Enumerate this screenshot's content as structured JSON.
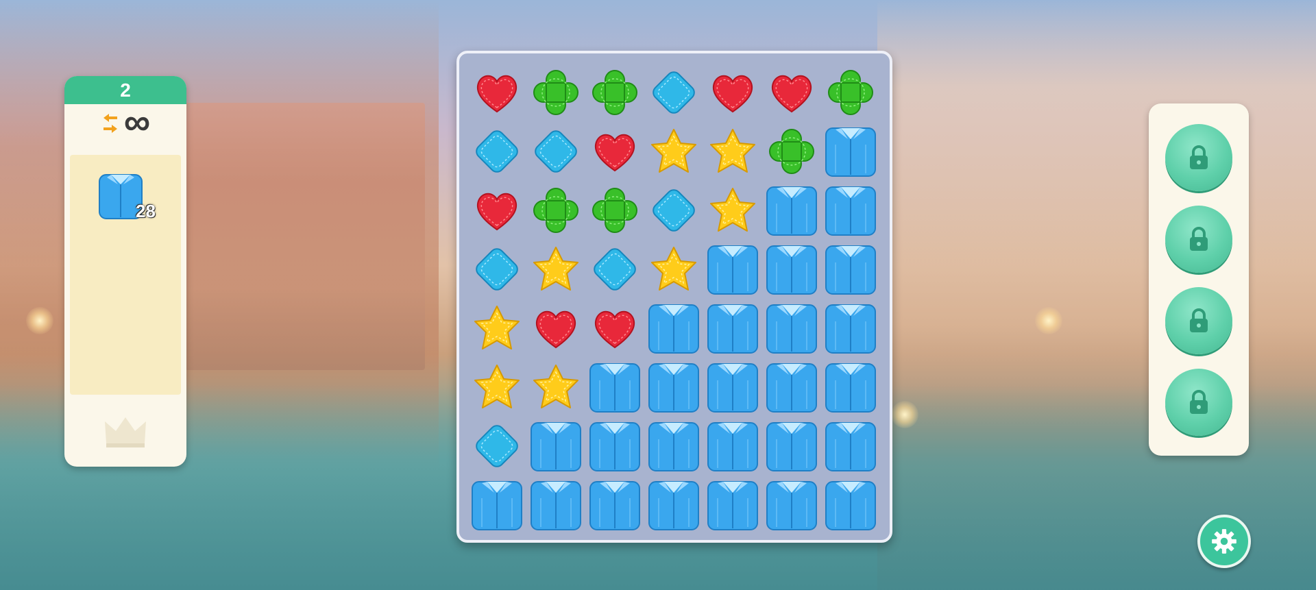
{
  "level": {
    "moves_label": "2",
    "moves_mode": "infinite"
  },
  "goal": {
    "item_icon": "blue-shirt-icon",
    "count": "28"
  },
  "board": {
    "rows": 8,
    "cols": 7,
    "grid": [
      [
        "heart",
        "clover",
        "clover",
        "diamond",
        "heart",
        "heart",
        "clover"
      ],
      [
        "diamond",
        "diamond",
        "heart",
        "star",
        "star",
        "clover",
        "shirt"
      ],
      [
        "heart",
        "clover",
        "clover",
        "diamond",
        "star",
        "shirt",
        "shirt"
      ],
      [
        "diamond",
        "star",
        "diamond",
        "star",
        "shirt",
        "shirt",
        "shirt"
      ],
      [
        "star",
        "heart",
        "heart",
        "shirt",
        "shirt",
        "shirt",
        "shirt"
      ],
      [
        "star",
        "star",
        "shirt",
        "shirt",
        "shirt",
        "shirt",
        "shirt"
      ],
      [
        "diamond",
        "shirt",
        "shirt",
        "shirt",
        "shirt",
        "shirt",
        "shirt"
      ],
      [
        "shirt",
        "shirt",
        "shirt",
        "shirt",
        "shirt",
        "shirt",
        "shirt"
      ]
    ]
  },
  "boosters": [
    {
      "icon": "lock-icon",
      "locked": true
    },
    {
      "icon": "lock-icon",
      "locked": true
    },
    {
      "icon": "lock-icon",
      "locked": true
    },
    {
      "icon": "lock-icon",
      "locked": true
    }
  ],
  "colors": {
    "accent": "#3dbf8e",
    "heart": "#e8283a",
    "clover": "#39c029",
    "diamond": "#2fb8e8",
    "star": "#ffcc1a",
    "shirt": "#3aa7ee"
  }
}
